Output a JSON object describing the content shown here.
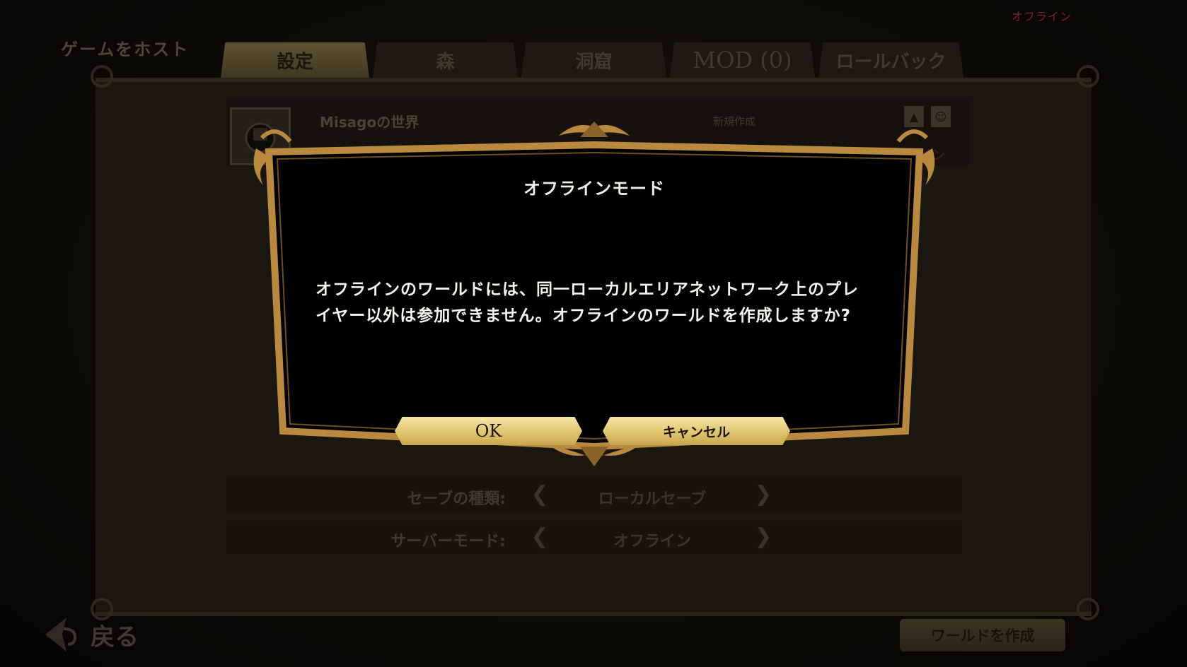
{
  "status_corner": "オフライン",
  "screen_title": "ゲームをホスト",
  "tabs": [
    {
      "label": "設定",
      "active": true
    },
    {
      "label": "森",
      "active": false
    },
    {
      "label": "洞窟",
      "active": false
    },
    {
      "label": "MOD (0)",
      "active": false
    },
    {
      "label": "ロールバック",
      "active": false
    }
  ],
  "world": {
    "name": "Misagoの世界",
    "state": "新規作成",
    "mode": "オフライン"
  },
  "settings": [
    {
      "label": "セーブの種類:",
      "value": "ローカルセーブ"
    },
    {
      "label": "サーバーモード:",
      "value": "オフライン"
    }
  ],
  "back_label": "戻る",
  "create_world_label": "ワールドを作成",
  "dialog": {
    "title": "オフラインモード",
    "body": "オフラインのワールドには、同一ローカルエリアネットワーク上のプレイヤー以外は参加できません。オフラインのワールドを作成しますか?",
    "ok_label": "OK",
    "cancel_label": "キャンセル"
  },
  "colors": {
    "frame_gold": "#b8893e",
    "button_gold": "#e8d07f",
    "offline_red": "#7a2033"
  }
}
